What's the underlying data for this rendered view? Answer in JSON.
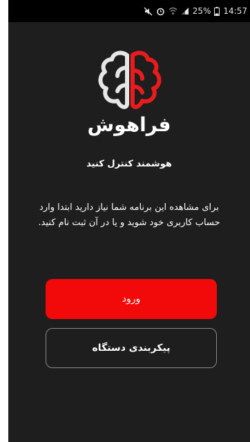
{
  "status_bar": {
    "battery_percent": "25%",
    "time": "14:57",
    "icons": [
      "mute-icon",
      "alarm-icon",
      "wifi-icon",
      "signal-icon",
      "battery-icon"
    ]
  },
  "brand": {
    "logo_icon": "brain-icon",
    "wordmark": "فراهوش",
    "colors": {
      "left_brain": "#e6e6e6",
      "right_brain": "#e81c1c"
    }
  },
  "welcome": {
    "headline": "هوشمند کنترل کنید",
    "description": "برای مشاهده این برنامه شما نیاز دارید ابتدا وارد حساب کاربری خود شوید و یا در آن ثبت نام کنید."
  },
  "actions": {
    "login_label": "ورود",
    "configure_device_label": "پیکربندی دستگاه"
  },
  "theme": {
    "background": "#1e1e1e",
    "accent": "#f20a0a"
  }
}
